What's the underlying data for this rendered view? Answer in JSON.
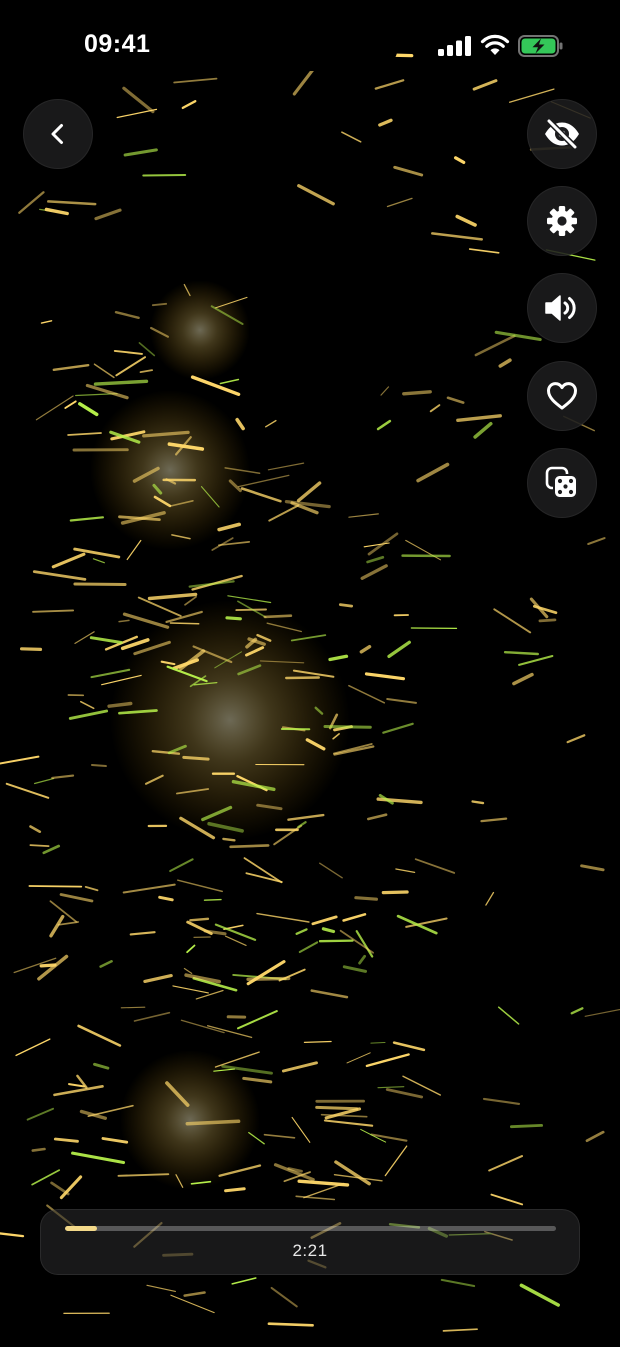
{
  "status_bar": {
    "time": "09:41",
    "signal_icon": "cellular-signal-icon",
    "wifi_icon": "wifi-icon",
    "battery_icon": "battery-charging-icon"
  },
  "controls": {
    "back": {
      "icon": "chevron-left-icon"
    },
    "hide_ui": {
      "icon": "eye-slash-icon"
    },
    "settings": {
      "icon": "gear-icon"
    },
    "sound": {
      "icon": "speaker-wave-icon"
    },
    "favorite": {
      "icon": "heart-outline-icon"
    },
    "random": {
      "icon": "dice-icon"
    }
  },
  "player": {
    "time": "2:21",
    "progress_fraction": 0.065
  },
  "colors": {
    "background": "#000000",
    "progress_fill": "#f3d98a",
    "battery_green": "#34c759",
    "spark_gold": "#ffd86a",
    "spark_green": "#b6f04a"
  }
}
